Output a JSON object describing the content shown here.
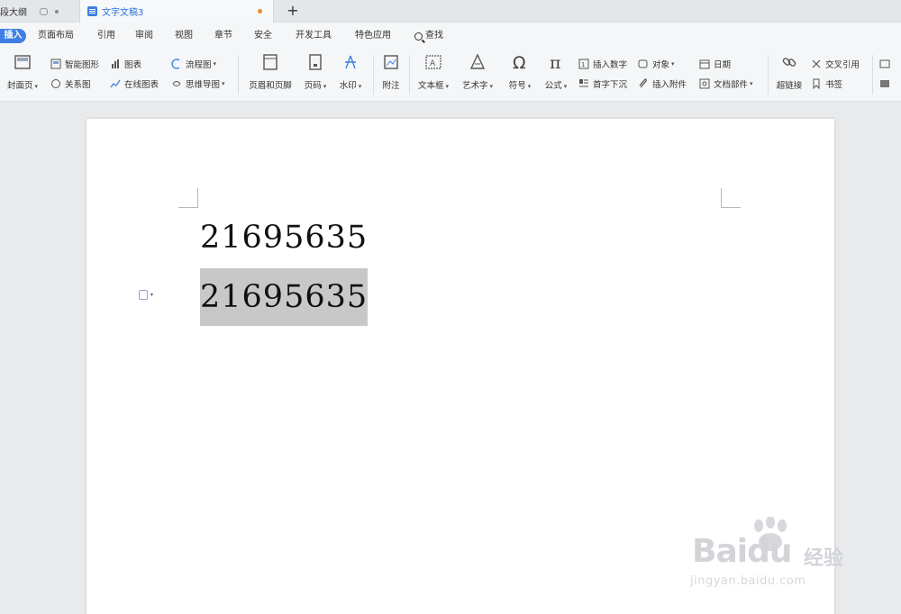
{
  "tabs": [
    {
      "label": "段大纲"
    },
    {
      "label": "文字文稿3"
    }
  ],
  "new_tab_label": "+",
  "menu": {
    "insert": "插入",
    "page_layout": "页面布局",
    "references": "引用",
    "review": "审阅",
    "view": "视图",
    "chapter": "章节",
    "security": "安全",
    "dev_tools": "开发工具",
    "features": "特色应用",
    "search": "查找"
  },
  "toolbar": {
    "cover": "封面页",
    "shape_chart": "智能图形",
    "chart": "图表",
    "flowchart": "流程图",
    "screenshot": "关系图",
    "online_chart": "在线图表",
    "mind_map": "思维导图",
    "page_break": "页眉和页脚",
    "page_number": "页码",
    "watermark": "水印",
    "attachment": "附注",
    "textbox": "文本框",
    "art_text": "艺术字",
    "symbol": "符号",
    "formula": "公式",
    "insert_number": "插入数字",
    "object": "对象",
    "date": "日期",
    "first_letter": "首字下沉",
    "insert_attachment": "插入附件",
    "doc_parts": "文档部件",
    "hyperlink": "超链接",
    "cross_ref": "交叉引用",
    "bookmark": "书签"
  },
  "document": {
    "line1": "21695635",
    "line2": "21695635"
  },
  "watermark": {
    "brand": "Bai",
    "brand_tail": "du",
    "sub": "经验",
    "url": "jingyan.baidu.com"
  },
  "colors": {
    "accent": "#3f7fe3",
    "selection": "#c8c8c8",
    "tab_active_text": "#2a6fd6"
  }
}
